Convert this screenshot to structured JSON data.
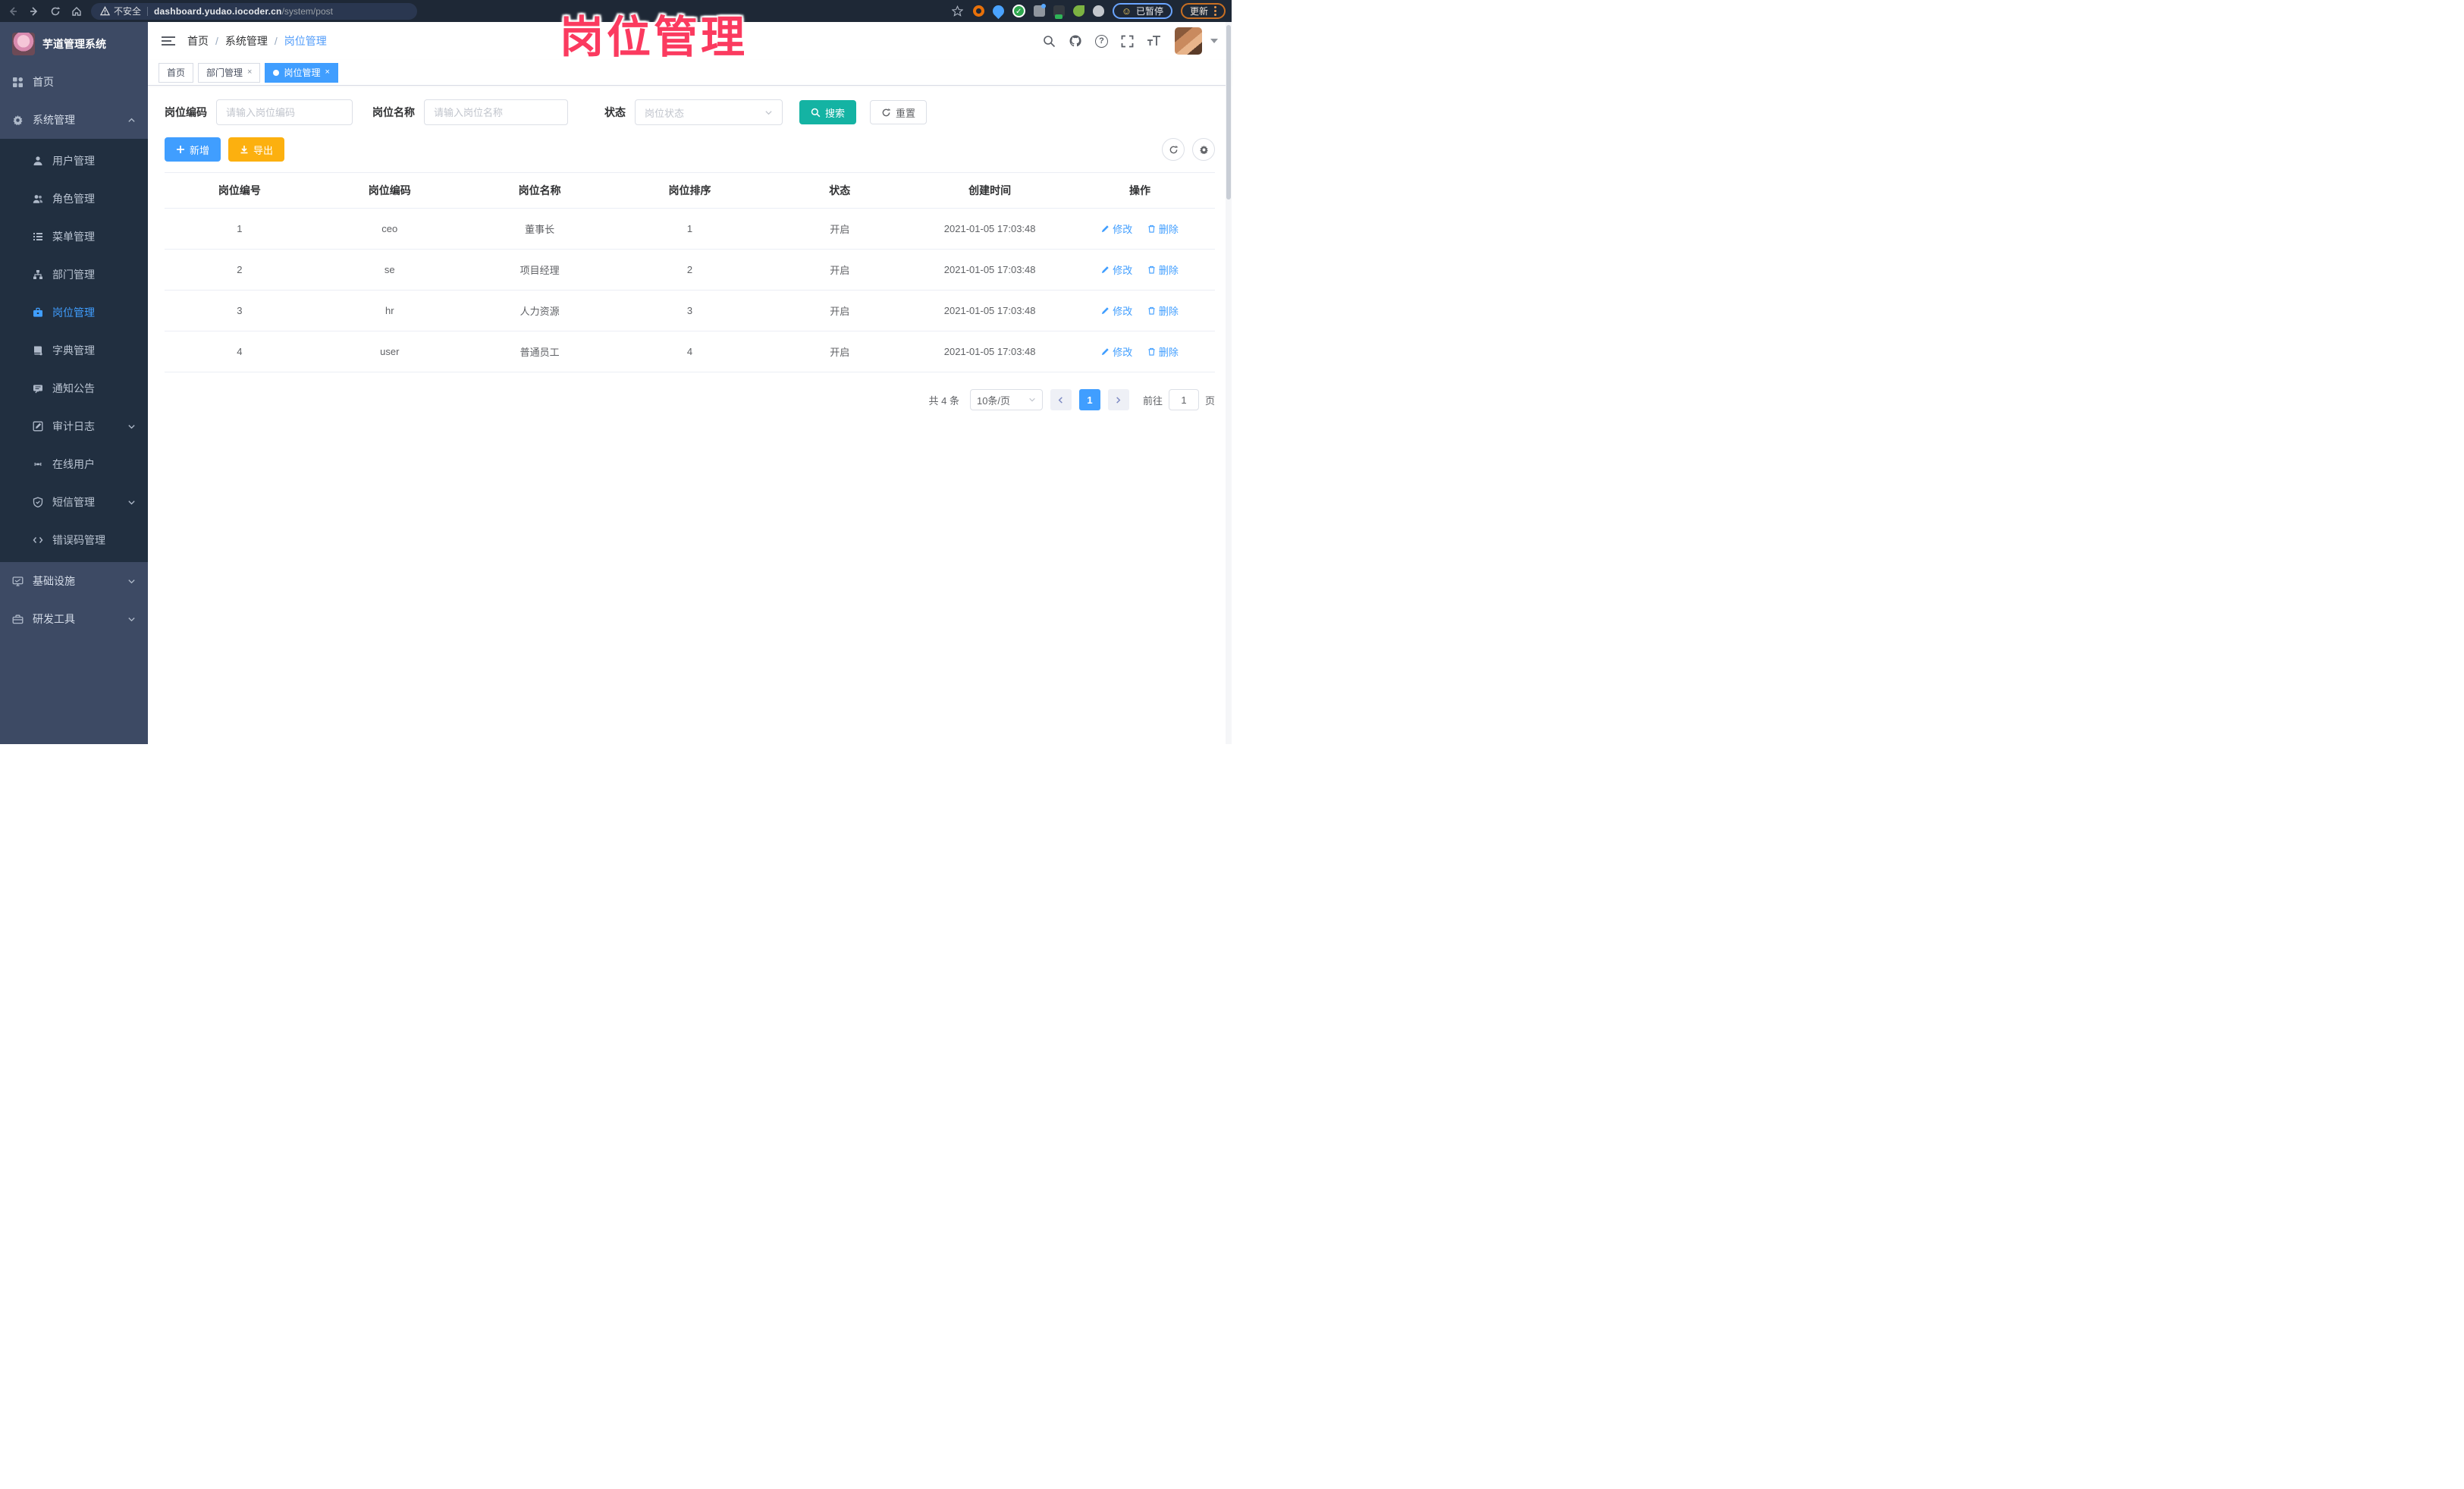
{
  "browser": {
    "security_label": "不安全",
    "url_domain": "dashboard.yudao.iocoder.cn",
    "url_path": "/system/post",
    "paused_label": "已暂停",
    "update_label": "更新"
  },
  "overlay_title": "岗位管理",
  "sidebar": {
    "app_title": "芋道管理系统",
    "items": {
      "home": "首页",
      "system": "系统管理",
      "infra": "基础设施",
      "devtools": "研发工具"
    },
    "system_children": [
      {
        "label": "用户管理"
      },
      {
        "label": "角色管理"
      },
      {
        "label": "菜单管理"
      },
      {
        "label": "部门管理"
      },
      {
        "label": "岗位管理",
        "active": true
      },
      {
        "label": "字典管理"
      },
      {
        "label": "通知公告"
      },
      {
        "label": "审计日志",
        "expandable": true
      },
      {
        "label": "在线用户"
      },
      {
        "label": "短信管理",
        "expandable": true
      },
      {
        "label": "错误码管理"
      }
    ]
  },
  "header": {
    "breadcrumb": [
      "首页",
      "系统管理",
      "岗位管理"
    ],
    "separator": "/"
  },
  "tabs": [
    {
      "label": "首页",
      "closable": false,
      "active": false
    },
    {
      "label": "部门管理",
      "closable": true,
      "active": false
    },
    {
      "label": "岗位管理",
      "closable": true,
      "active": true
    }
  ],
  "tab_close_glyph": "×",
  "filter": {
    "code": {
      "label": "岗位编码",
      "placeholder": "请输入岗位编码"
    },
    "name": {
      "label": "岗位名称",
      "placeholder": "请输入岗位名称"
    },
    "status": {
      "label": "状态",
      "placeholder": "岗位状态"
    },
    "search_label": "搜索",
    "reset_label": "重置"
  },
  "toolbar": {
    "add_label": "新增",
    "export_label": "导出"
  },
  "table": {
    "headers": [
      "岗位编号",
      "岗位编码",
      "岗位名称",
      "岗位排序",
      "状态",
      "创建时间",
      "操作"
    ],
    "edit_label": "修改",
    "delete_label": "删除",
    "rows": [
      {
        "id": "1",
        "code": "ceo",
        "name": "董事长",
        "sort": "1",
        "status": "开启",
        "time": "2021-01-05 17:03:48"
      },
      {
        "id": "2",
        "code": "se",
        "name": "项目经理",
        "sort": "2",
        "status": "开启",
        "time": "2021-01-05 17:03:48"
      },
      {
        "id": "3",
        "code": "hr",
        "name": "人力资源",
        "sort": "3",
        "status": "开启",
        "time": "2021-01-05 17:03:48"
      },
      {
        "id": "4",
        "code": "user",
        "name": "普通员工",
        "sort": "4",
        "status": "开启",
        "time": "2021-01-05 17:03:48"
      }
    ]
  },
  "pagination": {
    "total_text": "共 4 条",
    "page_size_text": "10条/页",
    "current_page": "1",
    "goto_prefix": "前往",
    "goto_value": "1",
    "goto_suffix": "页"
  },
  "icons": {
    "chrome": [
      "back-arrow",
      "forward-arrow",
      "reload",
      "home",
      "warning-triangle",
      "bookmark-star",
      "extensions",
      "smiley-paused",
      "kebab-menu"
    ],
    "navbar": [
      "hamburger",
      "search",
      "github",
      "question",
      "fullscreen",
      "font-size",
      "avatar",
      "caret-down"
    ],
    "accent_colors": {
      "blue": "#409eff",
      "teal": "#14b3a3",
      "orange": "#fcb00f",
      "annotation_pink": "#fb3a5f"
    }
  }
}
